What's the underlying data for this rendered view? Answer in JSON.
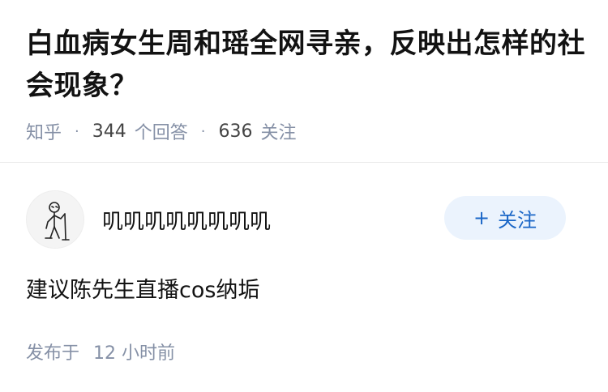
{
  "question": {
    "title": "白血病女生周和瑶全网寻亲，反映出怎样的社会现象？",
    "source": "知乎",
    "answer_count": "344",
    "answer_label": "个回答",
    "follower_count": "636",
    "follower_label": "关注"
  },
  "answer": {
    "author": {
      "name": "叽叽叽叽叽叽叽叽",
      "avatar_icon": "stick-figure-avatar-icon"
    },
    "follow_button": {
      "icon": "plus-icon",
      "label": "关注"
    },
    "content": "建议陈先生直播cos纳垢",
    "time_prefix": "发布于",
    "time_value": "12 小时前"
  },
  "colors": {
    "title": "#121212",
    "meta": "#8590a6",
    "follow_bg": "#ebf3fd",
    "follow_text": "#1a66c7",
    "divider": "#ebebeb"
  }
}
